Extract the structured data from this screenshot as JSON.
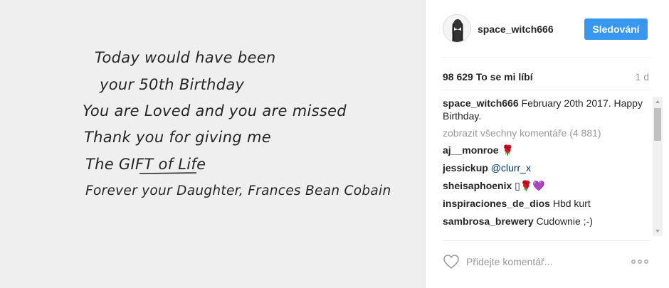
{
  "photo": {
    "lines": [
      "Today would have been",
      "your 50th Birthday",
      "You are Loved and you are missed",
      "Thank you for giving me",
      "The GIFT of Life",
      "Forever your Daughter, Frances Bean Cobain"
    ]
  },
  "header": {
    "username": "space_witch666",
    "follow_label": "Sledování"
  },
  "likes": {
    "count": "98 629",
    "label": "To se mi líbí",
    "time_ago": "1 d"
  },
  "caption": {
    "user": "space_witch666",
    "text": "February 20th 2017. Happy Birthday."
  },
  "load_more": "zobrazit všechny komentáře (4 881)",
  "comments": [
    {
      "user": "aj__monroe",
      "text": "🌹"
    },
    {
      "user": "jessickup",
      "text": "@clurr_x"
    },
    {
      "user": "sheisaphoenix",
      "text": "▯🌹💜"
    },
    {
      "user": "inspiraciones_de_dios",
      "text": "Hbd kurt"
    },
    {
      "user": "sambrosa_brewery",
      "text": "Cudownie ;-)"
    }
  ],
  "footer": {
    "comment_placeholder": "Přidejte komentář..."
  },
  "icons": {
    "heart": "heart-outline-icon",
    "more": "more-dots-icon",
    "avatar": "avatar"
  },
  "colors": {
    "accent": "#3897f0",
    "text": "#262626",
    "muted": "#999999"
  }
}
